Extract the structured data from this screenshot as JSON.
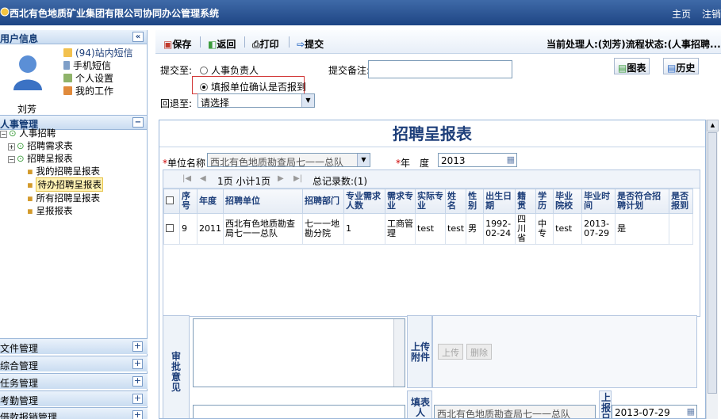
{
  "app": {
    "title": "西北有色地质矿业集团有限公司协同办公管理系统",
    "nav": [
      "主页",
      "注销"
    ]
  },
  "sidebar": {
    "user_header": "用户信息",
    "user_name": "刘芳",
    "user_menu": [
      {
        "label": "(94)站内短信",
        "icon": "mail-icon"
      },
      {
        "label": "手机短信",
        "icon": "phone-icon"
      },
      {
        "label": "个人设置",
        "icon": "settings-icon"
      },
      {
        "label": "我的工作",
        "icon": "work-icon"
      }
    ],
    "section_header": "人事管理",
    "tree": {
      "root": "人事招聘",
      "node1": "招聘需求表",
      "node2": "招聘呈报表",
      "children": [
        "我的招聘呈报表",
        "待办招聘呈报表",
        "所有招聘呈报表",
        "呈报报表"
      ],
      "selected_index": 1
    },
    "accordion": [
      "文件管理",
      "综合管理",
      "任务管理",
      "考勤管理",
      "借款报销管理"
    ]
  },
  "toolbar": {
    "save": "保存",
    "back": "返回",
    "print": "打印",
    "submit": "提交",
    "status": "当前处理人:(刘芳)流程状态:(人事招聘..."
  },
  "form": {
    "submit_to_label": "提交至:",
    "option_hr": "人事负责人",
    "option_confirm": "填报单位确认是否报到",
    "selected_option": "填报单位确认是否报到",
    "remark_label": "提交备注:",
    "remark_value": "",
    "return_label": "回退至:",
    "return_value": "请选择",
    "chart_btn": "图表",
    "history_btn": "历史"
  },
  "report": {
    "title": "招聘呈报表",
    "unit_label": "单位名称",
    "unit_value": "西北有色地质勘查局七一一总队",
    "year_label": "年　度",
    "year_value": "2013",
    "pager": {
      "page_info": "1页 小计1页",
      "total": "总记录数:(1)"
    },
    "columns": [
      "序号",
      "年度",
      "招聘单位",
      "招聘部门",
      "专业需求人数",
      "需求专业",
      "实际专业",
      "姓名",
      "性别",
      "出生日期",
      "籍贯",
      "学历",
      "毕业院校",
      "毕业时间",
      "是否符合招聘计划",
      "是否报到"
    ],
    "rows": [
      [
        "9",
        "2011",
        "西北有色地质勘查局七一一总队",
        "七一一地勘分院",
        "1",
        "工商管理",
        "test",
        "test",
        "男",
        "1992-02-24",
        "四川省",
        "中专",
        "test",
        "2013-07-29",
        "是",
        ""
      ]
    ],
    "approval_label": "审批意见",
    "approval_value": "",
    "upload_label": "上传附件",
    "upload_btn": "上传",
    "delete_btn": "删除",
    "fill_unit_label": "填表人",
    "fill_unit_value": "西北有色地质勘查局七一一总队",
    "report_date_label": "上报日",
    "report_date_value": "2013-07-29"
  }
}
